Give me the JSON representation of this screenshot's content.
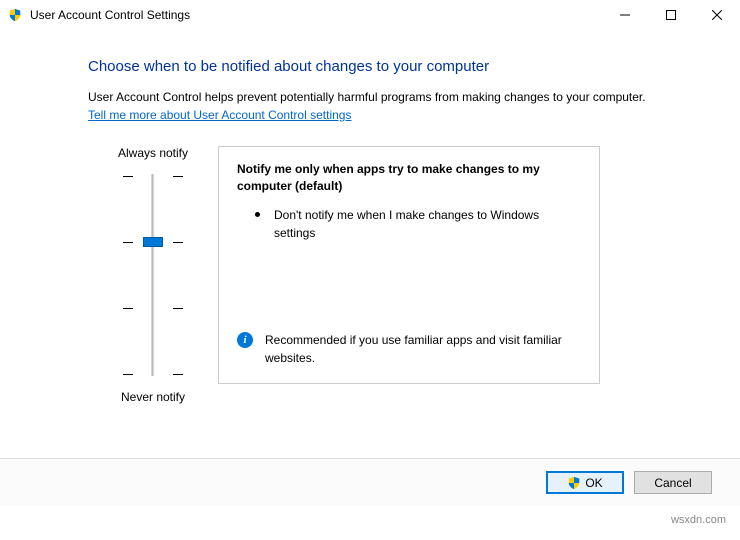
{
  "window": {
    "title": "User Account Control Settings"
  },
  "main": {
    "heading": "Choose when to be notified about changes to your computer",
    "description": "User Account Control helps prevent potentially harmful programs from making changes to your computer.",
    "link": "Tell me more about User Account Control settings"
  },
  "slider": {
    "top_label": "Always notify",
    "bottom_label": "Never notify",
    "levels": 4,
    "current_level": 1
  },
  "panel": {
    "title": "Notify me only when apps try to make changes to my computer (default)",
    "bullet": "Don't notify me when I make changes to Windows settings",
    "recommendation": "Recommended if you use familiar apps and visit familiar websites."
  },
  "footer": {
    "ok": "OK",
    "cancel": "Cancel"
  },
  "watermark": "wsxdn.com"
}
